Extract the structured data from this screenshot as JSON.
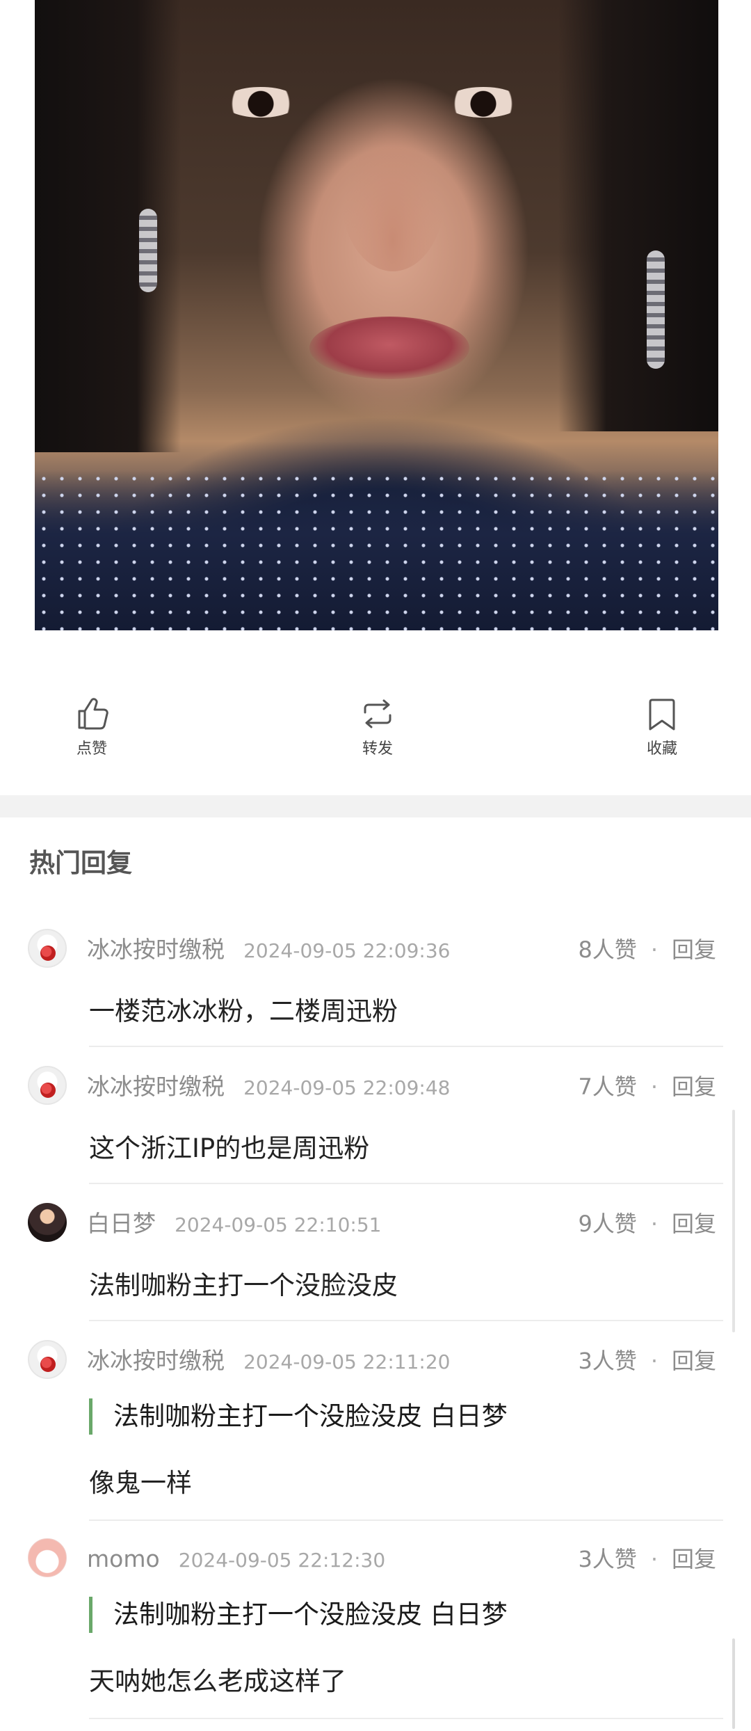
{
  "actions": [
    {
      "label": "点赞",
      "icon": "thumbs-up-icon"
    },
    {
      "label": "转发",
      "icon": "repost-icon"
    },
    {
      "label": "收藏",
      "icon": "bookmark-icon"
    }
  ],
  "hot_replies": {
    "title": "热门回复",
    "reply_label": "回复",
    "comments": [
      {
        "user": "冰冰按时缴税",
        "time": "2024-09-05 22:09:36",
        "likes": "8人赞",
        "text": "一楼范冰冰粉，二楼周迅粉",
        "quote": ""
      },
      {
        "user": "冰冰按时缴税",
        "time": "2024-09-05 22:09:48",
        "likes": "7人赞",
        "text": "这个浙江IP的也是周迅粉",
        "quote": ""
      },
      {
        "user": "白日梦",
        "time": "2024-09-05 22:10:51",
        "likes": "9人赞",
        "text": "法制咖粉主打一个没脸没皮",
        "quote": ""
      },
      {
        "user": "冰冰按时缴税",
        "time": "2024-09-05 22:11:20",
        "likes": "3人赞",
        "text": "像鬼一样",
        "quote": "法制咖粉主打一个没脸没皮 白日梦"
      },
      {
        "user": "momo",
        "time": "2024-09-05 22:12:30",
        "likes": "3人赞",
        "text": "天呐她怎么老成这样了",
        "quote": "法制咖粉主打一个没脸没皮 白日梦"
      }
    ]
  },
  "colors": {
    "quote_bar": "#6aa86a",
    "text": "#222222",
    "muted": "#8c8c8c"
  }
}
